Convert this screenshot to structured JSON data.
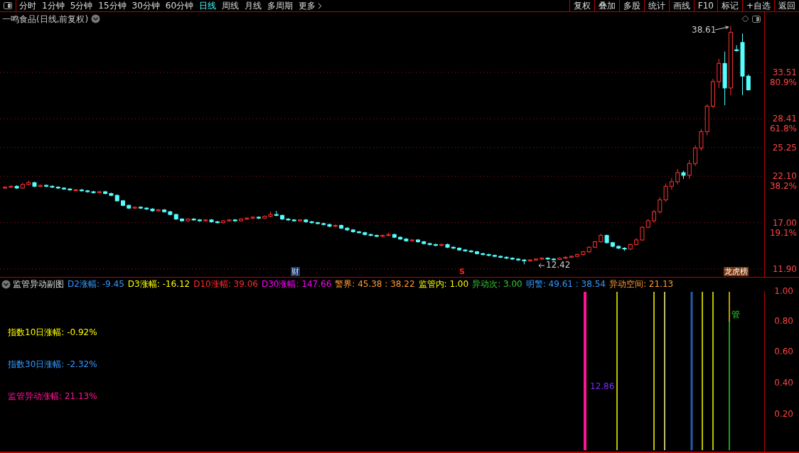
{
  "toolbar": {
    "periods": [
      {
        "label": "分时",
        "selected": false
      },
      {
        "label": "1分钟",
        "selected": false
      },
      {
        "label": "5分钟",
        "selected": false
      },
      {
        "label": "15分钟",
        "selected": false
      },
      {
        "label": "30分钟",
        "selected": false
      },
      {
        "label": "60分钟",
        "selected": false
      },
      {
        "label": "日线",
        "selected": true
      },
      {
        "label": "周线",
        "selected": false
      },
      {
        "label": "月线",
        "selected": false
      },
      {
        "label": "多周期",
        "selected": false
      },
      {
        "label": "更多",
        "selected": false
      }
    ],
    "buttons": [
      "复权",
      "叠加",
      "多股",
      "统计",
      "画线",
      "F10",
      "标记",
      "+自选",
      "返回"
    ]
  },
  "chart": {
    "title": "一鸣食品(日线,前复权)",
    "high_label": "38.61",
    "low_label": "12.42",
    "markers": [
      {
        "label": "财",
        "kind": "finance"
      },
      {
        "label": "S",
        "kind": "signal"
      },
      {
        "label": "龙虎榜",
        "kind": "list"
      }
    ],
    "chart_data": {
      "type": "candlestick",
      "grid": true,
      "ylim": [
        11.04,
        40.14
      ],
      "yticks": [
        {
          "value": 33.51,
          "label": "33.51"
        },
        {
          "value": 28.41,
          "label": "28.41"
        },
        {
          "value": 25.25,
          "label": "25.25"
        },
        {
          "value": 22.1,
          "label": "22.10"
        },
        {
          "value": 17,
          "label": "17.00"
        },
        {
          "value": 11.9,
          "label": "11.90"
        }
      ],
      "ohlc": [
        [
          20.8,
          21.0,
          20.7,
          20.9
        ],
        [
          20.9,
          21.1,
          20.8,
          21.0
        ],
        [
          21.0,
          21.1,
          20.7,
          20.8
        ],
        [
          20.8,
          21.4,
          20.7,
          21.2
        ],
        [
          21.2,
          21.6,
          21.1,
          21.4
        ],
        [
          21.4,
          21.5,
          20.9,
          21.0
        ],
        [
          21.0,
          21.2,
          20.9,
          21.1
        ],
        [
          21.1,
          21.2,
          20.9,
          21.0
        ],
        [
          21.0,
          21.1,
          20.8,
          20.9
        ],
        [
          20.9,
          21.0,
          20.7,
          20.8
        ],
        [
          20.8,
          20.9,
          20.6,
          20.7
        ],
        [
          20.7,
          20.8,
          20.5,
          20.6
        ],
        [
          20.6,
          20.7,
          20.5,
          20.6
        ],
        [
          20.6,
          20.7,
          20.4,
          20.5
        ],
        [
          20.5,
          20.6,
          20.3,
          20.4
        ],
        [
          20.4,
          20.5,
          20.2,
          20.3
        ],
        [
          20.3,
          20.5,
          20.2,
          20.4
        ],
        [
          20.4,
          20.5,
          20.1,
          20.2
        ],
        [
          20.2,
          20.3,
          19.9,
          20.0
        ],
        [
          20.0,
          20.1,
          19.3,
          19.4
        ],
        [
          19.4,
          19.5,
          18.8,
          18.9
        ],
        [
          18.9,
          19.0,
          18.5,
          18.6
        ],
        [
          18.6,
          18.8,
          18.5,
          18.7
        ],
        [
          18.7,
          18.8,
          18.5,
          18.6
        ],
        [
          18.6,
          18.7,
          18.4,
          18.5
        ],
        [
          18.5,
          18.6,
          18.2,
          18.3
        ],
        [
          18.3,
          18.5,
          18.2,
          18.4
        ],
        [
          18.4,
          18.5,
          18.1,
          18.2
        ],
        [
          18.2,
          18.3,
          17.8,
          17.9
        ],
        [
          17.9,
          18.0,
          17.3,
          17.4
        ],
        [
          17.4,
          17.5,
          17.1,
          17.2
        ],
        [
          17.2,
          17.5,
          17.1,
          17.4
        ],
        [
          17.4,
          17.5,
          17.2,
          17.3
        ],
        [
          17.3,
          17.4,
          17.1,
          17.2
        ],
        [
          17.2,
          17.4,
          17.1,
          17.3
        ],
        [
          17.3,
          17.4,
          17.0,
          17.1
        ],
        [
          17.1,
          17.2,
          16.9,
          17.0
        ],
        [
          17.0,
          17.3,
          16.9,
          17.2
        ],
        [
          17.2,
          17.4,
          17.1,
          17.3
        ],
        [
          17.3,
          17.4,
          17.1,
          17.2
        ],
        [
          17.2,
          17.5,
          17.1,
          17.4
        ],
        [
          17.4,
          17.6,
          17.3,
          17.5
        ],
        [
          17.5,
          17.7,
          17.4,
          17.6
        ],
        [
          17.6,
          17.7,
          17.4,
          17.5
        ],
        [
          17.5,
          17.8,
          17.4,
          17.7
        ],
        [
          17.7,
          18.2,
          17.6,
          17.9
        ],
        [
          17.9,
          18.3,
          17.7,
          17.8
        ],
        [
          17.8,
          17.9,
          17.3,
          17.4
        ],
        [
          17.4,
          17.5,
          17.2,
          17.3
        ],
        [
          17.3,
          17.4,
          17.1,
          17.2
        ],
        [
          17.2,
          17.4,
          17.1,
          17.3
        ],
        [
          17.3,
          17.4,
          17.0,
          17.1
        ],
        [
          17.1,
          17.2,
          16.9,
          17.0
        ],
        [
          17.0,
          17.1,
          16.8,
          16.9
        ],
        [
          16.9,
          17.0,
          16.7,
          16.8
        ],
        [
          16.8,
          16.9,
          16.5,
          16.6
        ],
        [
          16.6,
          16.8,
          16.5,
          16.7
        ],
        [
          16.7,
          16.8,
          16.3,
          16.4
        ],
        [
          16.4,
          16.5,
          16.1,
          16.2
        ],
        [
          16.2,
          16.3,
          15.9,
          16.0
        ],
        [
          16.0,
          16.1,
          15.8,
          15.9
        ],
        [
          15.9,
          16.0,
          15.6,
          15.7
        ],
        [
          15.7,
          15.8,
          15.5,
          15.6
        ],
        [
          15.6,
          15.7,
          15.4,
          15.5
        ],
        [
          15.5,
          15.7,
          15.4,
          15.6
        ],
        [
          15.6,
          15.9,
          15.5,
          15.7
        ],
        [
          15.7,
          15.8,
          15.3,
          15.4
        ],
        [
          15.4,
          15.5,
          15.1,
          15.2
        ],
        [
          15.2,
          15.3,
          14.9,
          15.0
        ],
        [
          15.0,
          15.2,
          14.9,
          15.1
        ],
        [
          15.1,
          15.2,
          14.8,
          14.9
        ],
        [
          14.9,
          15.0,
          14.6,
          14.7
        ],
        [
          14.7,
          14.8,
          14.5,
          14.6
        ],
        [
          14.6,
          14.7,
          14.4,
          14.5
        ],
        [
          14.5,
          14.7,
          14.4,
          14.6
        ],
        [
          14.6,
          14.7,
          14.2,
          14.3
        ],
        [
          14.3,
          14.4,
          14.1,
          14.2
        ],
        [
          14.2,
          14.3,
          13.9,
          14.0
        ],
        [
          14.0,
          14.1,
          13.8,
          13.9
        ],
        [
          13.9,
          14.0,
          13.7,
          13.8
        ],
        [
          13.8,
          13.9,
          13.5,
          13.6
        ],
        [
          13.6,
          13.7,
          13.4,
          13.5
        ],
        [
          13.5,
          13.6,
          13.3,
          13.4
        ],
        [
          13.4,
          13.5,
          13.2,
          13.3
        ],
        [
          13.3,
          13.4,
          13.1,
          13.2
        ],
        [
          13.2,
          13.3,
          13.0,
          13.1
        ],
        [
          13.1,
          13.2,
          12.9,
          13.0
        ],
        [
          13.0,
          13.1,
          12.8,
          12.9
        ],
        [
          12.9,
          13.0,
          12.42,
          12.8
        ],
        [
          12.8,
          13.0,
          12.7,
          12.9
        ],
        [
          12.9,
          13.1,
          12.8,
          13.0
        ],
        [
          13.0,
          13.2,
          12.9,
          13.1
        ],
        [
          13.1,
          13.2,
          12.9,
          13.0
        ],
        [
          13.0,
          13.1,
          12.8,
          12.95
        ],
        [
          12.95,
          13.2,
          12.9,
          13.1
        ],
        [
          13.1,
          13.3,
          13.0,
          13.2
        ],
        [
          13.2,
          13.4,
          13.1,
          13.3
        ],
        [
          13.3,
          13.6,
          13.2,
          13.5
        ],
        [
          13.5,
          13.9,
          13.4,
          13.8
        ],
        [
          13.8,
          14.4,
          13.7,
          14.3
        ],
        [
          14.3,
          15.0,
          14.2,
          14.9
        ],
        [
          14.9,
          15.8,
          14.8,
          15.6
        ],
        [
          15.6,
          15.7,
          14.7,
          14.8
        ],
        [
          14.8,
          14.9,
          14.3,
          14.4
        ],
        [
          14.4,
          14.5,
          14.1,
          14.2
        ],
        [
          14.2,
          14.3,
          13.9,
          14.1
        ],
        [
          14.1,
          14.7,
          14.0,
          14.6
        ],
        [
          14.6,
          15.3,
          14.5,
          15.1
        ],
        [
          15.1,
          16.6,
          15.0,
          16.5
        ],
        [
          16.5,
          17.4,
          16.4,
          17.2
        ],
        [
          17.2,
          18.4,
          17.0,
          18.2
        ],
        [
          18.2,
          19.8,
          18.0,
          19.5
        ],
        [
          19.5,
          21.3,
          19.3,
          21.0
        ],
        [
          21.0,
          21.9,
          20.6,
          21.5
        ],
        [
          21.5,
          22.9,
          21.2,
          22.5
        ],
        [
          22.5,
          22.7,
          21.8,
          22.2
        ],
        [
          22.2,
          23.9,
          21.8,
          23.5
        ],
        [
          23.5,
          25.5,
          23.2,
          25.2
        ],
        [
          25.2,
          27.3,
          24.9,
          27.0
        ],
        [
          27.0,
          30.0,
          26.6,
          29.8
        ],
        [
          29.8,
          32.8,
          29.6,
          32.5
        ],
        [
          32.5,
          35.0,
          31.8,
          34.5
        ],
        [
          34.5,
          35.8,
          29.9,
          31.8
        ],
        [
          31.8,
          38.61,
          31.0,
          37.9
        ],
        [
          36.0,
          36.5,
          35.8,
          35.9
        ],
        [
          36.8,
          37.8,
          31.0,
          33.1
        ],
        [
          33.1,
          33.3,
          31.5,
          31.6
        ]
      ]
    },
    "ratio_labels": [
      "80.9%",
      "61.8%",
      "38.2%",
      "19.1%"
    ]
  },
  "indicator": {
    "title": "监管异动副图",
    "items": [
      {
        "text": "D2涨幅: -9.45",
        "color": "#3399ff"
      },
      {
        "text": "D3涨幅: -16.12",
        "color": "#ffff00"
      },
      {
        "text": "D10涨幅: 39.06",
        "color": "#ff2a2a"
      },
      {
        "text": "D30涨幅: 147.66",
        "color": "#ff00ff"
      },
      {
        "text": "警界: 45.38 : 38.22",
        "color": "#ff9933"
      },
      {
        "text": "监管内: 1.00",
        "color": "#ffff00"
      },
      {
        "text": "异动次: 3.00",
        "color": "#33cc33"
      },
      {
        "text": "明警: 49.61 : 38.54",
        "color": "#3399ff"
      },
      {
        "text": "异动空间: 21.13",
        "color": "#ff9933"
      }
    ],
    "stats": [
      {
        "text": "指数10日涨幅: -0.92%",
        "color": "#ffff00"
      },
      {
        "text": "指数30日涨幅: -2.32%",
        "color": "#3399ff"
      },
      {
        "text": "监管异动涨幅: 21.13%",
        "color": "#ff1493"
      }
    ],
    "value_label": "12.86",
    "signal_label": "管",
    "axis": [
      "1.00",
      "0.80",
      "0.60",
      "0.40",
      "0.20"
    ]
  }
}
